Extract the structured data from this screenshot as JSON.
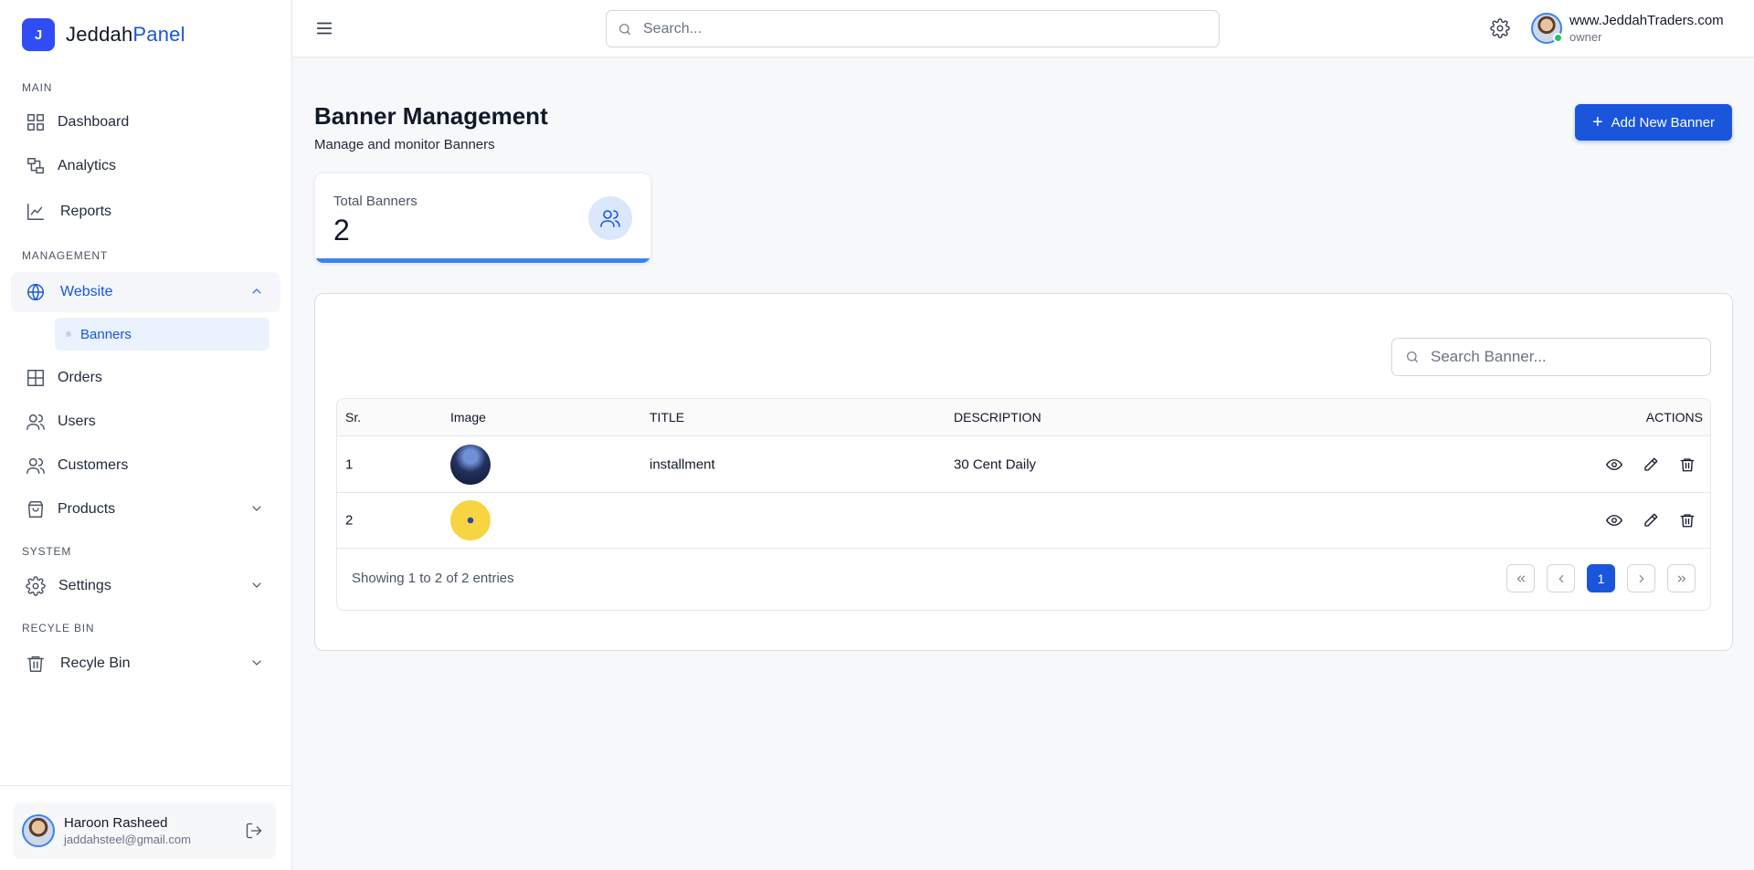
{
  "brand": {
    "logo_letter": "J",
    "name_part1": "Jeddah",
    "name_part2": "Panel",
    "accent_color": "#1a56db"
  },
  "sidebar": {
    "sections": {
      "main": "MAIN",
      "management": "MANAGEMENT",
      "system": "SYSTEM",
      "recycle": "RECYLE BIN"
    },
    "items": {
      "dashboard": "Dashboard",
      "analytics": "Analytics",
      "reports": "Reports",
      "website": "Website",
      "banners": "Banners",
      "orders": "Orders",
      "users": "Users",
      "customers": "Customers",
      "products": "Products",
      "settings": "Settings",
      "recycle_bin": "Recyle Bin"
    },
    "user": {
      "name": "Haroon Rasheed",
      "email": "jaddahsteel@gmail.com"
    }
  },
  "header": {
    "search_placeholder": "Search...",
    "site": "www.JeddahTraders.com",
    "role": "owner"
  },
  "page": {
    "title": "Banner Management",
    "subtitle": "Manage and monitor Banners",
    "add_button": "Add New Banner"
  },
  "stat": {
    "label": "Total Banners",
    "value": "2"
  },
  "table": {
    "search_placeholder": "Search Banner...",
    "columns": {
      "sr": "Sr.",
      "image": "Image",
      "title": "TITLE",
      "description": "DESCRIPTION",
      "actions": "ACTIONS"
    },
    "rows": [
      {
        "sr": "1",
        "image": "banner-installment-image",
        "title": "installment",
        "description": "30 Cent Daily"
      },
      {
        "sr": "2",
        "image": "banner-yellow-image",
        "title": "",
        "description": ""
      }
    ],
    "showing": "Showing 1 to 2 of 2 entries",
    "current_page": "1"
  }
}
